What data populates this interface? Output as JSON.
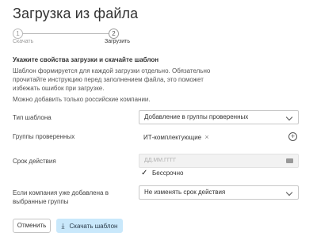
{
  "page": {
    "title": "Загрузка из файла"
  },
  "stepper": {
    "steps": [
      {
        "number": "1",
        "label": "Скачать",
        "active": false
      },
      {
        "number": "2",
        "label": "Загрузить",
        "active": true
      }
    ]
  },
  "instructions": {
    "heading": "Укажите свойства загрузки и скачайте шаблон",
    "description": "Шаблон формируется для каждой загрузки отдельно. Обязательно прочитайте инструкцию перед заполнением файла, это поможет избежать ошибок при загрузке.",
    "note": "Можно добавить только российские компании."
  },
  "form": {
    "template_type": {
      "label": "Тип шаблона",
      "value": "Добавление в группы проверенных"
    },
    "groups": {
      "label": "Группы проверенных",
      "tag": "ИТ-комплектующие",
      "tag_remove": "×",
      "add_icon": "plus-circle-icon"
    },
    "validity": {
      "label": "Срок действия",
      "placeholder": "ДД.ММ.ГГГГ",
      "indefinite_label": "Бессрочно",
      "indefinite_checked": true
    },
    "existing": {
      "label": "Если компания уже добавлена в выбранные группы",
      "value": "Не изменять срок действия"
    }
  },
  "actions": {
    "cancel_label": "Отменить",
    "download_label": "Скачать шаблон",
    "download_icon": "download-icon"
  },
  "colors": {
    "primary_button_bg": "#c9e8fb",
    "text": "#333333",
    "border": "#c8c8c8"
  }
}
